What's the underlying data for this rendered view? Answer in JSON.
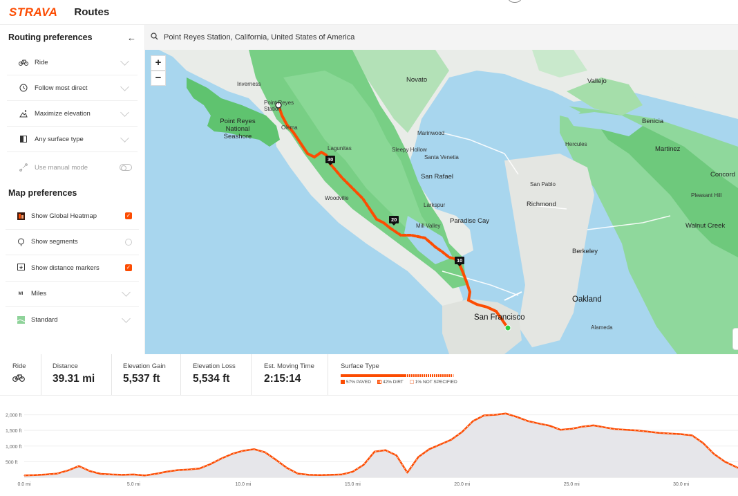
{
  "header": {
    "logo": "STRAVA",
    "title": "Routes"
  },
  "routing": {
    "title": "Routing preferences",
    "items": [
      {
        "label": "Ride",
        "icon": "bike-icon"
      },
      {
        "label": "Follow most direct",
        "icon": "clock-icon"
      },
      {
        "label": "Maximize elevation",
        "icon": "elevation-icon"
      },
      {
        "label": "Any surface type",
        "icon": "surface-icon"
      }
    ],
    "manual_mode": "Use manual mode"
  },
  "map_prefs": {
    "title": "Map preferences",
    "items": [
      {
        "label": "Show Global Heatmap",
        "checked": true,
        "icon": "heatmap-icon"
      },
      {
        "label": "Show segments",
        "checked": false,
        "icon": "segment-icon"
      },
      {
        "label": "Show distance markers",
        "checked": true,
        "icon": "distance-marker-icon"
      },
      {
        "label": "Miles",
        "icon": "units-icon"
      },
      {
        "label": "Standard",
        "icon": "map-style-icon"
      }
    ]
  },
  "search": {
    "value": "Point Reyes Station, California, United States of America"
  },
  "map": {
    "zoom_in": "+",
    "zoom_out": "−",
    "labels": {
      "novato": "Novato",
      "vallejo": "Vallejo",
      "inverness": "Inverness",
      "point_reyes_station": "Point Reyes Station",
      "point_reyes_ns": "Point Reyes National Seashore",
      "olema": "Olema",
      "marinwood": "Marinwood",
      "benicia": "Benicia",
      "hercules": "Hercules",
      "martinez": "Martinez",
      "lagunitas": "Lagunitas",
      "sleepy_hollow": "Sleepy Hollow",
      "santa_venetia": "Santa Venetia",
      "concord": "Concord",
      "san_rafael": "San Rafael",
      "san_pablo": "San Pablo",
      "pleasant_hill": "Pleasant Hill",
      "richmond": "Richmond",
      "larkspur": "Larkspur",
      "woodville": "Woodville",
      "paradise_cay": "Paradise Cay",
      "walnut_creek": "Walnut Creek",
      "mill_valley": "Mill Valley",
      "berkeley": "Berkeley",
      "oakland": "Oakland",
      "san_francisco": "San Francisco",
      "alameda": "Alameda"
    },
    "markers": {
      "m30": "30",
      "m20": "20",
      "m10": "10"
    }
  },
  "stats": {
    "mode": "Ride",
    "distance_label": "Distance",
    "distance": "39.31 mi",
    "gain_label": "Elevation Gain",
    "gain": "5,537 ft",
    "loss_label": "Elevation Loss",
    "loss": "5,534 ft",
    "time_label": "Est. Moving Time",
    "time": "2:15:14",
    "surface_label": "Surface Type",
    "surface": [
      {
        "label": "57% PAVED",
        "pct": 57,
        "color": "#fc4c02"
      },
      {
        "label": "42% DIRT",
        "pct": 42,
        "color": "#fc4c02"
      },
      {
        "label": "1% NOT SPECIFIED",
        "pct": 1,
        "color": "#f7b9a0"
      }
    ]
  },
  "chart_data": {
    "type": "area",
    "title": "",
    "xlabel": "",
    "ylabel": "",
    "x_ticks": [
      "0.0 mi",
      "5.0 mi",
      "10.0 mi",
      "15.0 mi",
      "20.0 mi",
      "25.0 mi",
      "30.0 mi"
    ],
    "y_ticks": [
      "500 ft",
      "1,000 ft",
      "1,500 ft",
      "2,000 ft"
    ],
    "xlim": [
      0,
      32.6
    ],
    "ylim": [
      0,
      2300
    ],
    "x": [
      0,
      0.5,
      1,
      1.5,
      2,
      2.5,
      3,
      3.5,
      4,
      4.5,
      5,
      5.5,
      6,
      6.5,
      7,
      7.5,
      8,
      8.5,
      9,
      9.5,
      10,
      10.5,
      11,
      11.5,
      12,
      12.5,
      13,
      13.5,
      14,
      14.5,
      15,
      15.5,
      16,
      16.5,
      17,
      17.5,
      18,
      18.5,
      19,
      19.5,
      20,
      20.5,
      21,
      21.5,
      22,
      22.5,
      23,
      23.5,
      24,
      24.5,
      25,
      25.5,
      26,
      26.5,
      27,
      27.5,
      28,
      28.5,
      29,
      29.5,
      30,
      30.5,
      31,
      31.5,
      32,
      32.6
    ],
    "y": [
      60,
      70,
      90,
      120,
      220,
      360,
      200,
      110,
      90,
      80,
      90,
      60,
      110,
      180,
      230,
      250,
      280,
      420,
      600,
      750,
      850,
      900,
      800,
      560,
      300,
      120,
      80,
      70,
      80,
      90,
      180,
      400,
      820,
      870,
      700,
      150,
      650,
      900,
      1050,
      1200,
      1450,
      1800,
      1980,
      2000,
      2040,
      1930,
      1800,
      1720,
      1650,
      1520,
      1550,
      1620,
      1660,
      1600,
      1540,
      1520,
      1500,
      1460,
      1420,
      1400,
      1380,
      1340,
      1100,
      750,
      500,
      300
    ]
  }
}
